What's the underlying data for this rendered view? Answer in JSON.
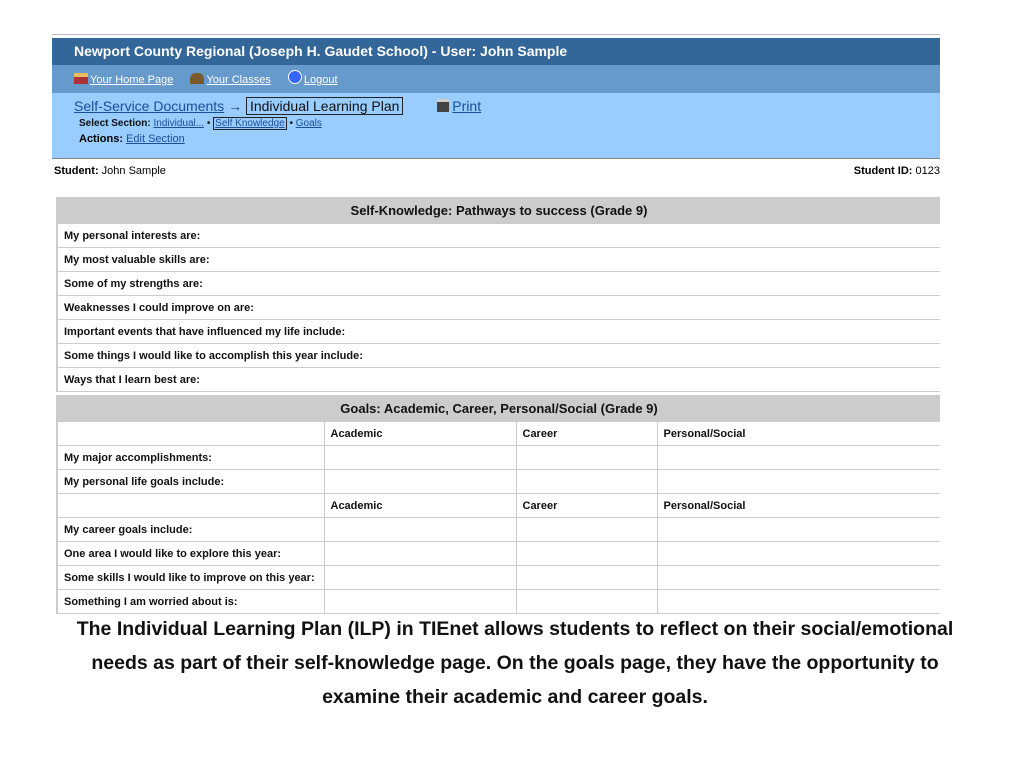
{
  "header": {
    "title": "Newport County Regional (Joseph H. Gaudet School) -  User: John Sample"
  },
  "nav": {
    "home": "Your Home Page",
    "classes": "Your Classes",
    "logout": "Logout"
  },
  "breadcrumb": {
    "parent": "Self-Service Documents",
    "arrow": "→",
    "current": "Individual Learning Plan",
    "print": "Print"
  },
  "section": {
    "label": "Select Section:",
    "items": [
      "Individual...",
      "Self Knowledge",
      "Goals"
    ],
    "sep": "•"
  },
  "actions": {
    "label": "Actions:",
    "edit": "Edit Section"
  },
  "student": {
    "label": "Student:",
    "name": "John Sample",
    "id_label": "Student ID:",
    "id": "0123"
  },
  "self_knowledge": {
    "title": "Self-Knowledge: Pathways to success (Grade 9)",
    "rows": [
      "My personal interests are:",
      "My most valuable skills are:",
      "Some of my strengths are:",
      "Weaknesses I could improve on are:",
      "Important events that have influenced my life include:",
      "Some things I would like to accomplish this year include:",
      "Ways that I learn best are:"
    ]
  },
  "goals": {
    "title": "Goals: Academic, Career, Personal/Social (Grade 9)",
    "columns": [
      "Academic",
      "Career",
      "Personal/Social"
    ],
    "rows_a": [
      "My major accomplishments:",
      "My personal life goals include:"
    ],
    "rows_b": [
      "My career goals include:",
      "One area I would like to explore this year:",
      "Some skills I would like to improve on this year:",
      "Something I am worried about is:"
    ]
  },
  "caption": {
    "line1": "The Individual Learning Plan (ILP) in TIEnet allows students to reflect on their social/emotional",
    "line2": "needs  as part of their self-knowledge page.  On the goals page, they have the opportunity to",
    "line3": "examine their academic and career goals."
  }
}
